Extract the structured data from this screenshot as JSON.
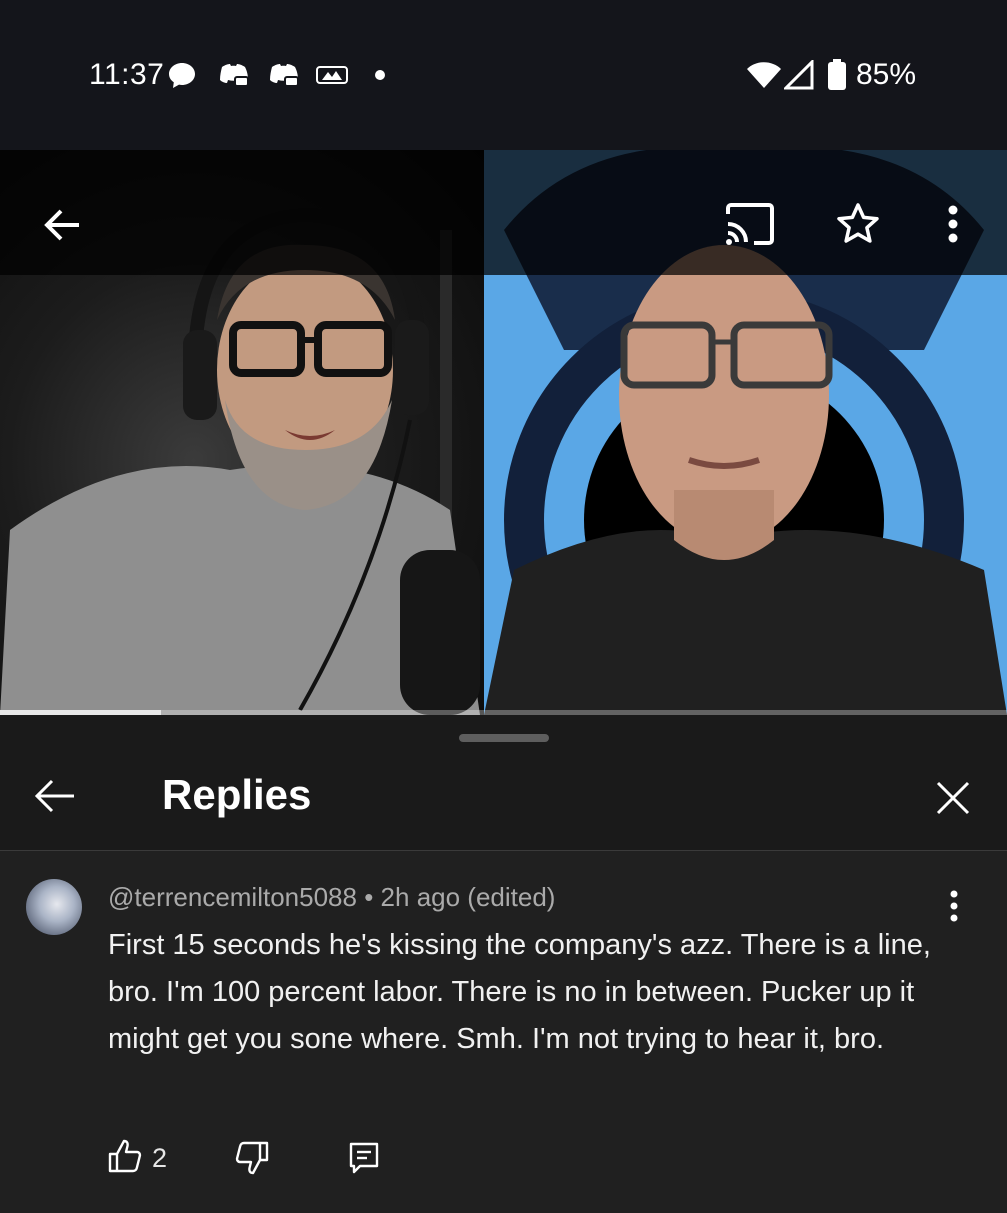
{
  "status_bar": {
    "time": "11:37",
    "battery": "85%",
    "icons": [
      "messages-icon",
      "discord-icon",
      "discord-icon",
      "mlb-icon",
      "dot-icon",
      "wifi-icon",
      "signal-icon",
      "battery-icon"
    ]
  },
  "video": {
    "progress": 0.16,
    "overlay_icons": [
      "back-arrow-icon",
      "cast-icon",
      "star-icon",
      "more-vert-icon"
    ]
  },
  "replies": {
    "title": "Replies"
  },
  "comment": {
    "author": "@terrencemilton5088",
    "separator": "•",
    "time": "2h ago (edited)",
    "text": "First 15 seconds he's kissing the company's azz. There is a line, bro. I'm 100 percent labor. There is no in between. Pucker up it might get you sone where. Smh. I'm not trying to hear it, bro.",
    "like_count": "2"
  },
  "colors": {
    "status_bg": "#14151b",
    "sheet_bg": "#202020",
    "header_bg": "#1a1a1a",
    "meta_text": "#aaaaaa",
    "video_right_bg": "#5aa7e6"
  }
}
